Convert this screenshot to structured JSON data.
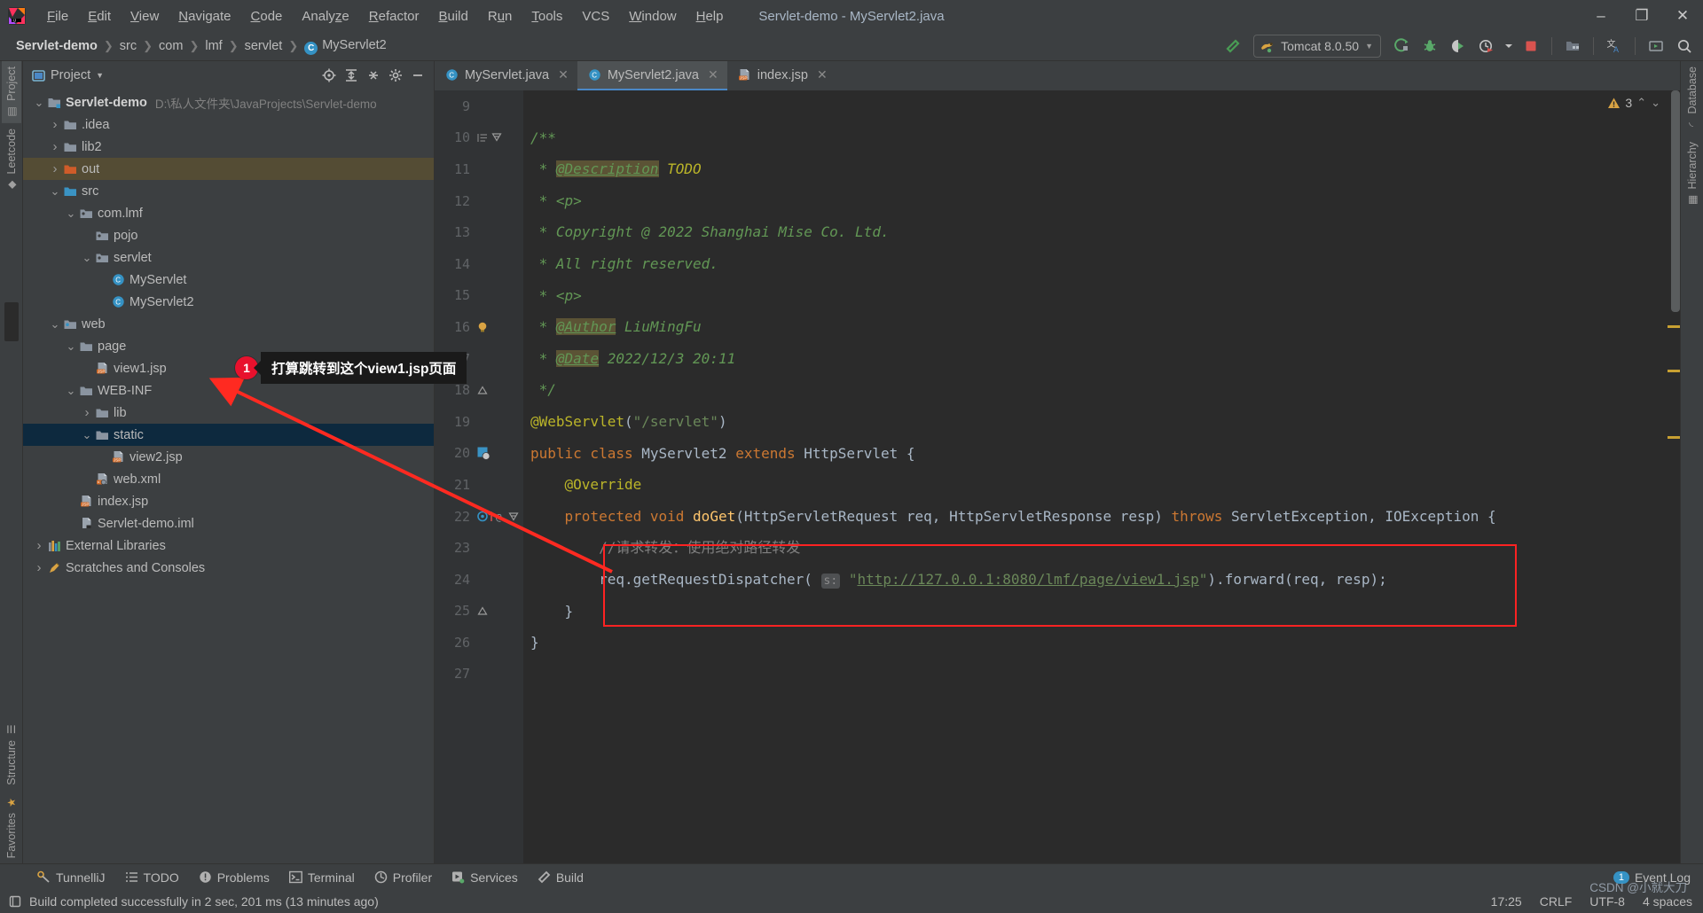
{
  "window": {
    "title": "Servlet-demo - MyServlet2.java",
    "minimize": "–",
    "maximize": "❐",
    "close": "✕"
  },
  "menubar": {
    "logo_icon": "intellij-idea-logo",
    "items": [
      {
        "label": "File",
        "mnemonic": "F"
      },
      {
        "label": "Edit",
        "mnemonic": "E"
      },
      {
        "label": "View",
        "mnemonic": "V"
      },
      {
        "label": "Navigate",
        "mnemonic": "N"
      },
      {
        "label": "Code",
        "mnemonic": "C"
      },
      {
        "label": "Analyze",
        "mnemonic": "z"
      },
      {
        "label": "Refactor",
        "mnemonic": "R"
      },
      {
        "label": "Build",
        "mnemonic": "B"
      },
      {
        "label": "Run",
        "mnemonic": "u"
      },
      {
        "label": "Tools",
        "mnemonic": "T"
      },
      {
        "label": "VCS",
        "mnemonic": ""
      },
      {
        "label": "Window",
        "mnemonic": "W"
      },
      {
        "label": "Help",
        "mnemonic": "H"
      }
    ]
  },
  "navbar": {
    "breadcrumb": [
      "Servlet-demo",
      "src",
      "com",
      "lmf",
      "servlet",
      "MyServlet2"
    ],
    "class_badge": "C",
    "separator": "❯",
    "build_icon": "hammer-icon",
    "run_config": {
      "label": "Tomcat 8.0.50",
      "icon": "tomcat-icon",
      "chevron": "▼"
    },
    "actions": [
      {
        "name": "run-button",
        "icon": "run-green-arrow"
      },
      {
        "name": "debug-button",
        "icon": "debug-bug-icon"
      },
      {
        "name": "run-coverage-button",
        "icon": "coverage-icon"
      },
      {
        "name": "profiler-button",
        "icon": "profiler-clock-icon"
      },
      {
        "name": "profiler-dropdown",
        "icon": "chevron-down-icon"
      },
      {
        "name": "stop-button",
        "icon": "stop-square-icon"
      },
      {
        "name": "update-app-button",
        "icon": "update-folder-icon"
      },
      {
        "name": "translate-button",
        "icon": "translate-icon"
      },
      {
        "name": "screen-button",
        "icon": "presentation-icon"
      },
      {
        "name": "search-everywhere-button",
        "icon": "search-icon"
      }
    ]
  },
  "left_strip": {
    "tabs": [
      {
        "label": "Project",
        "icon": "project-icon",
        "active": true
      },
      {
        "label": "Leetcode",
        "icon": "leetcode-icon",
        "active": false
      }
    ],
    "bottom_tabs": [
      {
        "label": "Structure",
        "icon": "structure-icon"
      },
      {
        "label": "Favorites",
        "icon": "favorites-star-icon"
      }
    ]
  },
  "right_strip": {
    "tabs": [
      {
        "label": "Database",
        "icon": "database-icon"
      },
      {
        "label": "Hierarchy",
        "icon": "hierarchy-icon"
      }
    ]
  },
  "project_panel": {
    "title": "Project",
    "chevron": "▼",
    "view_icon": "project-view-icon",
    "actions": [
      {
        "name": "select-opened-file-button",
        "icon": "crosshair-icon"
      },
      {
        "name": "expand-all-button",
        "icon": "expand-all-icon"
      },
      {
        "name": "collapse-all-button",
        "icon": "collapse-all-icon"
      },
      {
        "name": "settings-button",
        "icon": "gear-icon"
      },
      {
        "name": "hide-panel-button",
        "icon": "minus-icon"
      }
    ],
    "tree": [
      {
        "label": "Servlet-demo",
        "path": "D:\\私人文件夹\\JavaProjects\\Servlet-demo",
        "depth": 0,
        "twist": "open",
        "icon": "module-folder",
        "bold": true,
        "sel": ""
      },
      {
        "label": ".idea",
        "depth": 1,
        "twist": "closed",
        "icon": "folder-gray",
        "sel": ""
      },
      {
        "label": "lib2",
        "depth": 1,
        "twist": "closed",
        "icon": "folder-gray",
        "sel": ""
      },
      {
        "label": "out",
        "depth": 1,
        "twist": "closed",
        "icon": "folder-orange",
        "sel": "amber"
      },
      {
        "label": "src",
        "depth": 1,
        "twist": "open",
        "icon": "folder-source",
        "sel": ""
      },
      {
        "label": "com.lmf",
        "depth": 2,
        "twist": "open",
        "icon": "package-icon",
        "sel": ""
      },
      {
        "label": "pojo",
        "depth": 3,
        "twist": "none",
        "icon": "package-icon",
        "sel": ""
      },
      {
        "label": "servlet",
        "depth": 3,
        "twist": "open",
        "icon": "package-icon",
        "sel": ""
      },
      {
        "label": "MyServlet",
        "depth": 4,
        "twist": "none",
        "icon": "java-class-icon",
        "sel": ""
      },
      {
        "label": "MyServlet2",
        "depth": 4,
        "twist": "none",
        "icon": "java-class-icon",
        "sel": ""
      },
      {
        "label": "web",
        "depth": 1,
        "twist": "open",
        "icon": "web-folder-icon",
        "sel": ""
      },
      {
        "label": "page",
        "depth": 2,
        "twist": "open",
        "icon": "folder-gray",
        "sel": ""
      },
      {
        "label": "view1.jsp",
        "depth": 3,
        "twist": "none",
        "icon": "jsp-file-icon",
        "sel": ""
      },
      {
        "label": "WEB-INF",
        "depth": 2,
        "twist": "open",
        "icon": "folder-gray",
        "sel": ""
      },
      {
        "label": "lib",
        "depth": 3,
        "twist": "closed",
        "icon": "folder-gray",
        "sel": ""
      },
      {
        "label": "static",
        "depth": 3,
        "twist": "open",
        "icon": "folder-gray",
        "sel": "blue"
      },
      {
        "label": "view2.jsp",
        "depth": 4,
        "twist": "none",
        "icon": "jsp-file-icon",
        "sel": ""
      },
      {
        "label": "web.xml",
        "depth": 3,
        "twist": "none",
        "icon": "xml-file-icon",
        "sel": ""
      },
      {
        "label": "index.jsp",
        "depth": 2,
        "twist": "none",
        "icon": "jsp-file-icon",
        "sel": ""
      },
      {
        "label": "Servlet-demo.iml",
        "depth": 2,
        "twist": "none",
        "icon": "iml-file-icon",
        "sel": ""
      },
      {
        "label": "External Libraries",
        "depth": 0,
        "twist": "closed",
        "icon": "libraries-icon",
        "sel": ""
      },
      {
        "label": "Scratches and Consoles",
        "depth": 0,
        "twist": "closed",
        "icon": "scratches-icon",
        "sel": ""
      }
    ]
  },
  "editor": {
    "tabs": [
      {
        "label": "MyServlet.java",
        "icon": "java-class-icon",
        "active": false,
        "close": "✕"
      },
      {
        "label": "MyServlet2.java",
        "icon": "java-class-icon",
        "active": true,
        "close": "✕"
      },
      {
        "label": "index.jsp",
        "icon": "jsp-file-icon",
        "active": false,
        "close": "✕"
      }
    ],
    "inspection": {
      "count": "3",
      "icon": "warning-triangle-icon",
      "caret_up": "⌃",
      "caret_down": "⌄"
    },
    "first_line_number": 9,
    "lines": [
      {
        "n": 9,
        "marks": [],
        "code": ""
      },
      {
        "n": 10,
        "marks": [
          "indent-guide",
          "fold-open"
        ],
        "code": "/**",
        "kind": "jdoc"
      },
      {
        "n": 11,
        "marks": [],
        "code": " * @Description TODO",
        "kind": "jdoc-tag",
        "tag": "@Description",
        "rest": "TODO"
      },
      {
        "n": 12,
        "marks": [],
        "code": " * <p>",
        "kind": "jdoc"
      },
      {
        "n": 13,
        "marks": [],
        "code": " * Copyright @ 2022 Shanghai Mise Co. Ltd.",
        "kind": "jdoc"
      },
      {
        "n": 14,
        "marks": [],
        "code": " * All right reserved.",
        "kind": "jdoc"
      },
      {
        "n": 15,
        "marks": [],
        "code": " * <p>",
        "kind": "jdoc"
      },
      {
        "n": 16,
        "marks": [
          "bulb"
        ],
        "code": " * @Author LiuMingFu",
        "kind": "jdoc-tag",
        "tag": "@Author",
        "rest": "LiuMingFu"
      },
      {
        "n": 17,
        "marks": [],
        "code": " * @Date 2022/12/3 20:11",
        "kind": "jdoc-tag",
        "tag": "@Date",
        "rest": "2022/12/3 20:11"
      },
      {
        "n": 18,
        "marks": [
          "fold-end"
        ],
        "code": " */",
        "kind": "jdoc"
      },
      {
        "n": 19,
        "marks": [],
        "code": "@WebServlet(\"/servlet\")",
        "kind": "anno-line"
      },
      {
        "n": 20,
        "marks": [
          "web-mark"
        ],
        "code": "public class MyServlet2 extends HttpServlet {",
        "kind": "class-line"
      },
      {
        "n": 21,
        "marks": [],
        "code": "    @Override",
        "kind": "override-line"
      },
      {
        "n": 22,
        "marks": [
          "override-gutter",
          "fold-open"
        ],
        "code": "    protected void doGet(HttpServletRequest req, HttpServletResponse resp) throws ServletException, IOException {",
        "kind": "method-line"
      },
      {
        "n": 23,
        "marks": [],
        "code": "        //请求转发：使用绝对路径转发",
        "kind": "comment-line"
      },
      {
        "n": 24,
        "marks": [],
        "code": "        req.getRequestDispatcher( s: \"http://127.0.0.1:8080/lmf/page/view1.jsp\").forward(req, resp);",
        "kind": "dispatch-line",
        "hint": "s:",
        "url": "\"http://127.0.0.1:8080/lmf/page/view1.jsp\""
      },
      {
        "n": 25,
        "marks": [
          "fold-end"
        ],
        "code": "    }",
        "kind": "plain"
      },
      {
        "n": 26,
        "marks": [],
        "code": "}",
        "kind": "plain"
      },
      {
        "n": 27,
        "marks": [],
        "code": "",
        "kind": "plain"
      }
    ]
  },
  "annotation": {
    "badge": "1",
    "text": "打算跳转到这个view1.jsp页面",
    "arrow_color": "#ff2a21",
    "box_color": "#ff2222"
  },
  "bottom_tabs": [
    {
      "label": "TunnelliJ",
      "icon": "tunnel-icon"
    },
    {
      "label": "TODO",
      "icon": "todo-list-icon"
    },
    {
      "label": "Problems",
      "icon": "problems-icon"
    },
    {
      "label": "Terminal",
      "icon": "terminal-icon"
    },
    {
      "label": "Profiler",
      "icon": "profiler-icon"
    },
    {
      "label": "Services",
      "icon": "services-icon"
    },
    {
      "label": "Build",
      "icon": "build-hammer-icon"
    }
  ],
  "event_log": {
    "label": "Event Log",
    "count": "1"
  },
  "statusbar": {
    "message": "Build completed successfully in 2 sec, 201 ms (13 minutes ago)",
    "message_icon": "build-status-icon",
    "time": "17:25",
    "line_separator": "CRLF",
    "encoding": "UTF-8",
    "indent": "4 spaces",
    "watermark": "CSDN @小就大刀"
  },
  "colors": {
    "accent_blue": "#3592c4",
    "panel_bg": "#3c3f41",
    "editor_bg": "#2b2b2b",
    "selection_blue": "#0d293e",
    "selection_amber": "#544c34",
    "annotation_red": "#ff2a21"
  }
}
